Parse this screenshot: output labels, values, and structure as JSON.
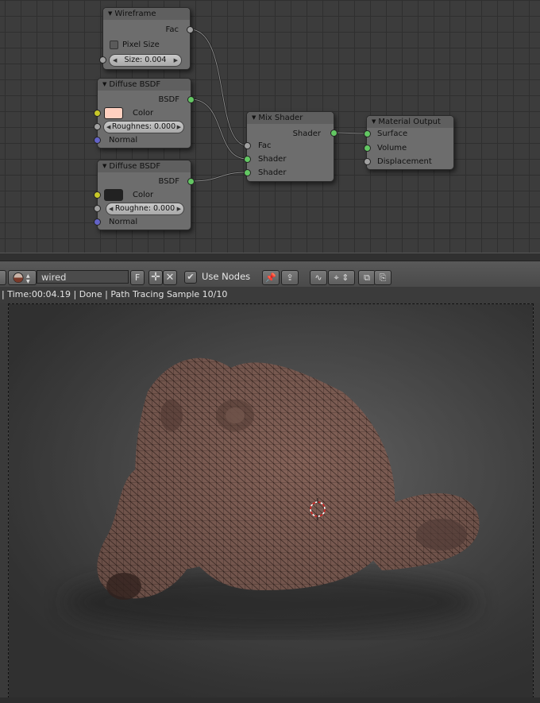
{
  "node_editor": {
    "nodes": {
      "wireframe": {
        "title": "Wireframe",
        "output_fac": "Fac",
        "pixel_size_label": "Pixel Size",
        "size_field": "Size: 0.004"
      },
      "diffuse1": {
        "title": "Diffuse BSDF",
        "output": "BSDF",
        "color_label": "Color",
        "color_value": "#ffd0c0",
        "roughness_field": "Roughnes: 0.000",
        "normal_label": "Normal"
      },
      "diffuse2": {
        "title": "Diffuse BSDF",
        "output": "BSDF",
        "color_label": "Color",
        "color_value": "#222222",
        "roughness_field": "Roughne: 0.000",
        "normal_label": "Normal"
      },
      "mix_shader": {
        "title": "Mix Shader",
        "output": "Shader",
        "input_fac": "Fac",
        "input_shader1": "Shader",
        "input_shader2": "Shader"
      },
      "material_output": {
        "title": "Material Output",
        "input_surface": "Surface",
        "input_volume": "Volume",
        "input_displacement": "Displacement"
      }
    }
  },
  "header": {
    "material_name": "wired",
    "fake_user_label": "F",
    "use_nodes_label": "Use Nodes",
    "use_nodes_checked": true
  },
  "status": {
    "text": "| Time:00:04.19 | Done | Path Tracing Sample 10/10"
  },
  "colors": {
    "socket_shader": "#63c763",
    "socket_float": "#a1a1a1",
    "socket_color": "#c7c729",
    "socket_vector": "#6363c7",
    "mesh_base": "#8a6a5f"
  }
}
